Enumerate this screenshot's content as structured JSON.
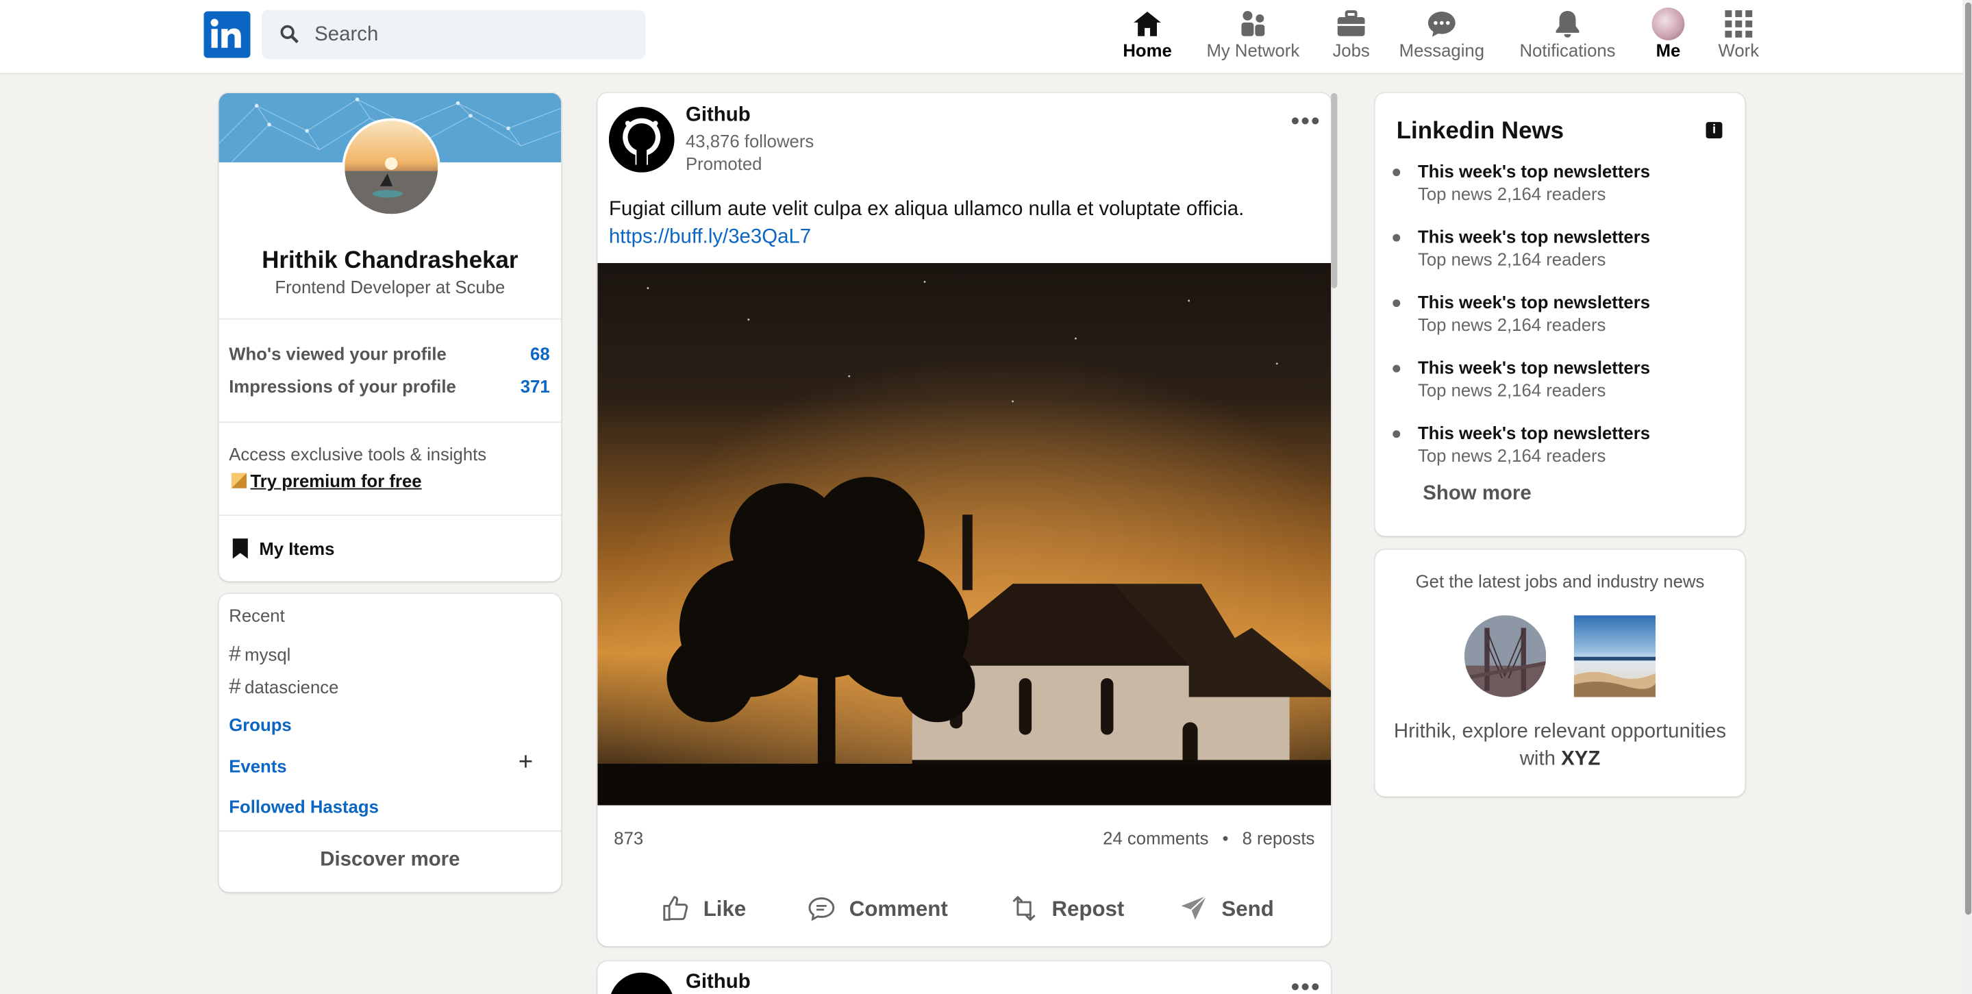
{
  "search": {
    "placeholder": "Search"
  },
  "nav": {
    "home": "Home",
    "network": "My Network",
    "jobs": "Jobs",
    "messaging": "Messaging",
    "notifications": "Notifications",
    "me": "Me",
    "work": "Work"
  },
  "profile": {
    "name": "Hrithik Chandrashekar",
    "title": "Frontend Developer at Scube",
    "viewed_label": "Who's viewed your profile",
    "viewed_value": "68",
    "impressions_label": "Impressions of your profile",
    "impressions_value": "371",
    "premium_text": "Access exclusive tools & insights",
    "premium_link": "Try premium for free",
    "my_items": "My Items"
  },
  "recent": {
    "heading": "Recent",
    "tags": [
      "mysql",
      "datascience"
    ],
    "groups": "Groups",
    "events": "Events",
    "plus": "+",
    "followed": "Followed Hastags",
    "discover": "Discover more"
  },
  "post": {
    "company": "Github",
    "followers": "43,876 followers",
    "promoted": "Promoted",
    "more": "•••",
    "text": "Fugiat cillum aute velit culpa ex aliqua ullamco nulla et voluptate officia.",
    "link": "https://buff.ly/3e3QaL7",
    "reactions": "873",
    "comments": "24 comments",
    "separator": "•",
    "reposts": "8 reposts",
    "actions": {
      "like": "Like",
      "comment": "Comment",
      "repost": "Repost",
      "send": "Send"
    }
  },
  "post2": {
    "company": "Github",
    "more": "•••"
  },
  "news": {
    "heading": "Linkedin News",
    "items": [
      {
        "title": "This week's top newsletters",
        "sub": "Top news 2,164 readers"
      },
      {
        "title": "This week's top newsletters",
        "sub": "Top news 2,164 readers"
      },
      {
        "title": "This week's top newsletters",
        "sub": "Top news 2,164 readers"
      },
      {
        "title": "This week's top newsletters",
        "sub": "Top news 2,164 readers"
      },
      {
        "title": "This week's top newsletters",
        "sub": "Top news 2,164 readers"
      }
    ],
    "show_more": "Show more"
  },
  "promo": {
    "heading": "Get the latest jobs and industry news",
    "message_prefix": "Hrithik, explore relevant opportunities with ",
    "message_brand": "XYZ"
  },
  "colors": {
    "brand": "#0a66c2",
    "background": "#f3f2ef"
  },
  "icons": [
    "search-icon",
    "home-icon",
    "network-icon",
    "briefcase-icon",
    "messaging-icon",
    "bell-icon",
    "grid-icon",
    "bookmark-icon",
    "like-icon",
    "comment-icon",
    "repost-icon",
    "send-icon",
    "info-icon",
    "github-icon"
  ]
}
